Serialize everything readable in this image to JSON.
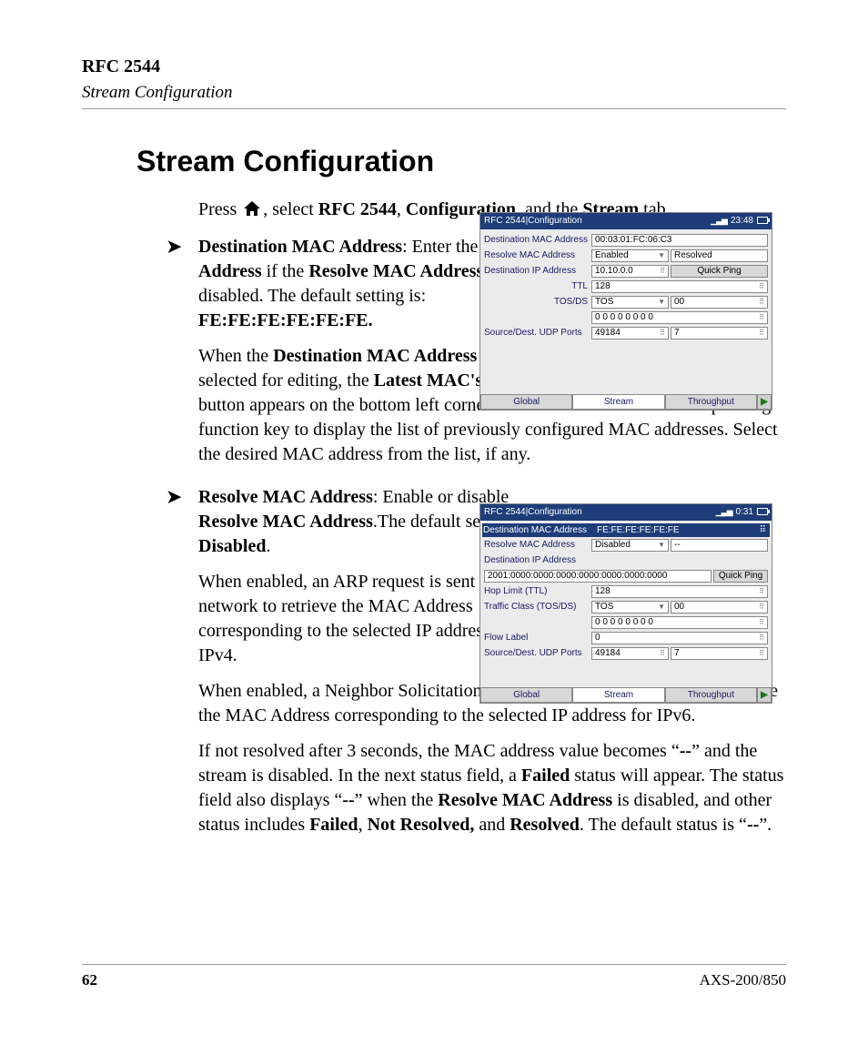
{
  "header": {
    "title": "RFC 2544",
    "subtitle": "Stream Configuration"
  },
  "section_title": "Stream Configuration",
  "intro": {
    "prefix": "Press ",
    "mid": ", select ",
    "rfc": "RFC 2544",
    "sep1": ", ",
    "conf": "Configuration",
    "sep2": ", and the ",
    "stream": "Stream",
    "suffix": " tab."
  },
  "bullet1": {
    "lead_bold": "Destination MAC Address",
    "lead_rest": ": Enter the ",
    "b1": "MAC Address",
    "r1": " if the ",
    "b2": "Resolve MAC Address",
    "r2": " is disabled. The default setting is: ",
    "b3": "FE:FE:FE:FE:FE:FE.",
    "p2a": "When the ",
    "p2b1": "Destination MAC Address",
    "p2r1": " field is selected for editing, the ",
    "p2b2": "Latest MAC's",
    "p2r2": " button appears on the bottom left corner of the screen. Press the corresponding function key to display the list of previously configured MAC addresses. Select the desired MAC address from the list, if any."
  },
  "bullet2": {
    "lead_bold": "Resolve MAC Address",
    "lead_rest": ": Enable or disable ",
    "b1": "Resolve MAC Address",
    "r1": ".The default setting is ",
    "b2": "Disabled",
    "r2": ".",
    "p2": "When enabled, an ARP request is sent to the network to retrieve the MAC Address corresponding to the selected IP address for IPv4.",
    "p3": "When enabled, a Neighbor Solicitation request is sent to the network to retrieve the MAC Address corresponding to the selected IP address for IPv6.",
    "p4a": "If not resolved after 3 seconds, the MAC address value becomes “",
    "p4b1": "--",
    "p4r1": "” and the stream is disabled. In the next status field, a ",
    "p4b2": "Failed",
    "p4r2": " status will appear. The status field also displays “",
    "p4b3": "--",
    "p4r3": "” when the ",
    "p4b4": "Resolve MAC Address",
    "p4r4": " is disabled, and other status includes ",
    "p4b5": "Failed",
    "p4s1": ", ",
    "p4b6": "Not Resolved,",
    "p4s2": " and ",
    "p4b7": "Resolved",
    "p4r5": ". The default status is “",
    "p4b8": "--",
    "p4r6": "”."
  },
  "shot1": {
    "title": "RFC 2544|Configuration",
    "time": "23:48",
    "rows": {
      "dmac_lbl": "Destination MAC Address",
      "dmac_val": "00:03:01:FC:06:C3",
      "rmac_lbl": "Resolve MAC Address",
      "rmac_val": "Enabled",
      "rmac_status": "Resolved",
      "dip_lbl": "Destination IP Address",
      "dip_val": "10.10.0.0",
      "qp": "Quick Ping",
      "ttl_lbl": "TTL",
      "ttl_val": "128",
      "tos_lbl": "TOS/DS",
      "tos_val": "TOS",
      "tos2": "00",
      "bits": "0 0 0 0 0 0 0 0",
      "udp_lbl": "Source/Dest. UDP Ports",
      "udp1": "49184",
      "udp2": "7"
    },
    "tabs": {
      "t1": "Global",
      "t2": "Stream",
      "t3": "Throughput"
    }
  },
  "shot2": {
    "title": "RFC 2544|Configuration",
    "time": "0:31",
    "sel": {
      "lbl": "Destination MAC Address",
      "val": "FE:FE:FE:FE:FE:FE"
    },
    "rows": {
      "rmac_lbl": "Resolve MAC Address",
      "rmac_val": "Disabled",
      "rmac_status": "--",
      "dip_lbl": "Destination IP Address",
      "ipv6": "2001:0000:0000:0000:0000:0000:0000:0000",
      "qp": "Quick Ping",
      "hop_lbl": "Hop Limit (TTL)",
      "hop_val": "128",
      "tc_lbl": "Traffic Class (TOS/DS)",
      "tc_val": "TOS",
      "tc2": "00",
      "bits": "0 0 0 0 0 0 0 0",
      "flow_lbl": "Flow Label",
      "flow_val": "0",
      "udp_lbl": "Source/Dest. UDP Ports",
      "udp1": "49184",
      "udp2": "7"
    },
    "tabs": {
      "t1": "Global",
      "t2": "Stream",
      "t3": "Throughput"
    }
  },
  "footer": {
    "page": "62",
    "model": "AXS-200/850"
  }
}
